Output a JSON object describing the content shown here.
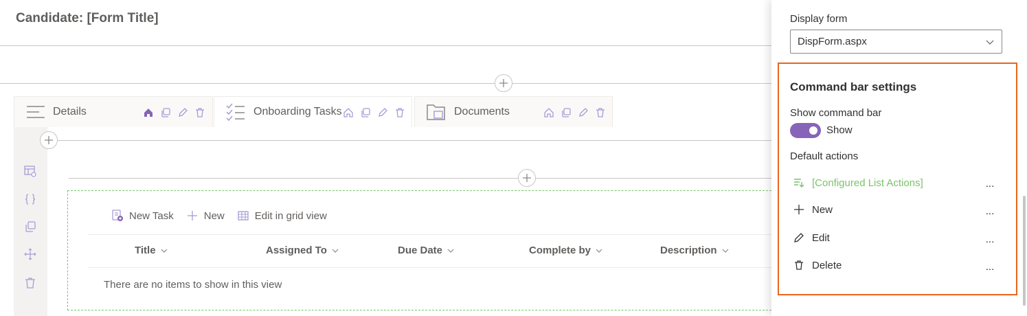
{
  "form": {
    "title": "Candidate: [Form Title]"
  },
  "tabs": [
    {
      "label": "Details",
      "icon": "details-lines-icon",
      "active": false
    },
    {
      "label": "Onboarding Tasks",
      "icon": "checklist-icon",
      "active": true
    },
    {
      "label": "Documents",
      "icon": "folder-documents-icon",
      "active": false
    }
  ],
  "tab_action_icons": [
    "home-icon",
    "copy-icon",
    "edit-icon",
    "delete-icon"
  ],
  "left_rail_icons": [
    "table-settings-icon",
    "code-braces-icon",
    "copy-icon",
    "move-icon",
    "delete-icon"
  ],
  "list": {
    "commands": [
      {
        "label": "New Task",
        "icon": "new-task-icon"
      },
      {
        "label": "New",
        "icon": "plus-icon"
      },
      {
        "label": "Edit in grid view",
        "icon": "grid-icon"
      }
    ],
    "columns": [
      "Title",
      "Assigned To",
      "Due Date",
      "Complete by",
      "Description"
    ],
    "empty_message": "There are no items to show in this view"
  },
  "panel": {
    "display_form_label": "Display form",
    "display_form_value": "DispForm.aspx",
    "command_bar_title": "Command bar settings",
    "show_command_bar_label": "Show command bar",
    "toggle_state": "Show",
    "default_actions_label": "Default actions",
    "actions": [
      {
        "label": "[Configured List Actions]",
        "icon": "list-actions-icon",
        "color": "#7ac36a"
      },
      {
        "label": "New",
        "icon": "plus-icon",
        "color": "#323130"
      },
      {
        "label": "Edit",
        "icon": "edit-icon",
        "color": "#323130"
      },
      {
        "label": "Delete",
        "icon": "delete-icon",
        "color": "#323130"
      }
    ],
    "more_label": "..."
  },
  "colors": {
    "accent": "#8764b8",
    "icon_purple": "#a89bd4",
    "highlight_border": "#e8651c",
    "configured_green": "#7ac36a"
  }
}
